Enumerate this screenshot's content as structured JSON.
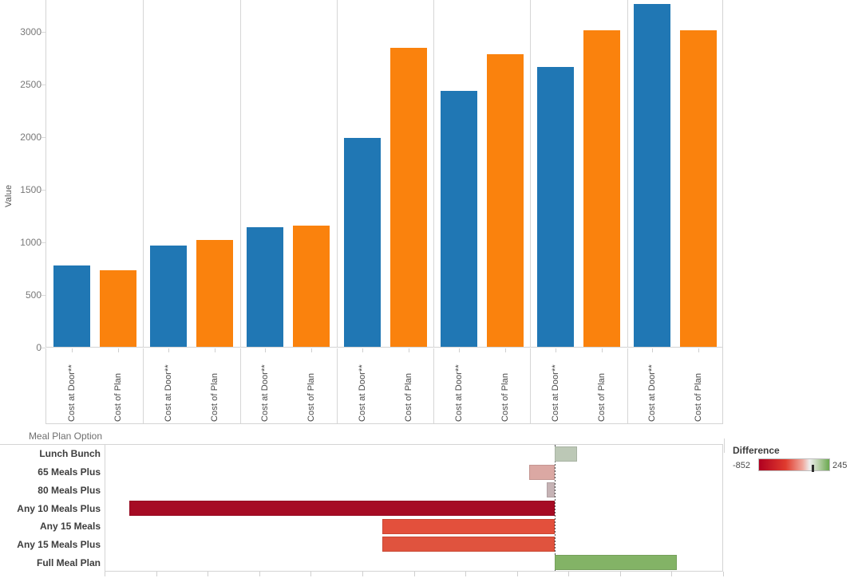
{
  "chart_data": [
    {
      "type": "bar",
      "title": "",
      "xlabel": "",
      "ylabel": "Value",
      "ylim": [
        0,
        3300
      ],
      "yticks": [
        0,
        500,
        1000,
        1500,
        2000,
        2500,
        3000
      ],
      "grid": false,
      "legend": "none",
      "groups": [
        "Lunch Bunch",
        "65 Meals Plus",
        "80 Meals Plus",
        "Any 10 Meals Plus",
        "Any 15 Meals",
        "Any 15 Meals Plus",
        "Full Meal Plan"
      ],
      "categories": [
        "Cost at Door**",
        "Cost of Plan",
        "Cost at Door**",
        "Cost of Plan",
        "Cost at Door**",
        "Cost of Plan",
        "Cost at Door**",
        "Cost of Plan",
        "Cost at Door**",
        "Cost of Plan",
        "Cost at Door**",
        "Cost of Plan",
        "Cost at Door**",
        "Cost of Plan"
      ],
      "series": [
        {
          "name": "Cost at Door**",
          "color": "#2077b4",
          "values": [
            770,
            965,
            1135,
            1985,
            2430,
            2660,
            3255
          ]
        },
        {
          "name": "Cost of Plan",
          "color": "#fa820d",
          "values": [
            725,
            1015,
            1150,
            2840,
            2775,
            3005,
            3005
          ]
        }
      ],
      "values": [
        770,
        725,
        965,
        1015,
        1135,
        1150,
        1985,
        2840,
        2430,
        2775,
        2660,
        3005,
        3255,
        3005
      ]
    },
    {
      "type": "bar",
      "orientation": "horizontal",
      "title": "",
      "row_header": "Meal Plan Option",
      "categories": [
        "Lunch Bunch",
        "65 Meals Plus",
        "80 Meals Plus",
        "Any 10 Meals Plus",
        "Any 15 Meals",
        "Any 15 Meals Plus",
        "Full Meal Plan"
      ],
      "values": [
        45,
        -50,
        -15,
        -852,
        -345,
        -345,
        245
      ],
      "colors": [
        "#bcc8b6",
        "#dba8a3",
        "#c6b3b5",
        "#a60b24",
        "#e3503c",
        "#e0533e",
        "#83b366"
      ],
      "ylabel": "",
      "xlabel": "",
      "legend": {
        "title": "Difference",
        "min": "-852",
        "max": "245",
        "gradient_from": "#b00020",
        "gradient_mid": "#ededed",
        "gradient_to": "#6aa84f"
      }
    }
  ],
  "bar_chart": {
    "y_axis_title": "Value",
    "y_ticks": [
      "3000",
      "2500",
      "2000",
      "1500",
      "1000",
      "500",
      "0"
    ],
    "cat_door": "Cost at Door**",
    "cat_plan": "Cost of Plan"
  },
  "diff_chart": {
    "header": "Meal Plan Option",
    "rows": [
      "Lunch Bunch",
      "65 Meals Plus",
      "80 Meals Plus",
      "Any 10 Meals Plus",
      "Any 15 Meals",
      "Any 15 Meals Plus",
      "Full Meal Plan"
    ]
  },
  "legend": {
    "title": "Difference",
    "min_label": "-852",
    "max_label": "245"
  }
}
